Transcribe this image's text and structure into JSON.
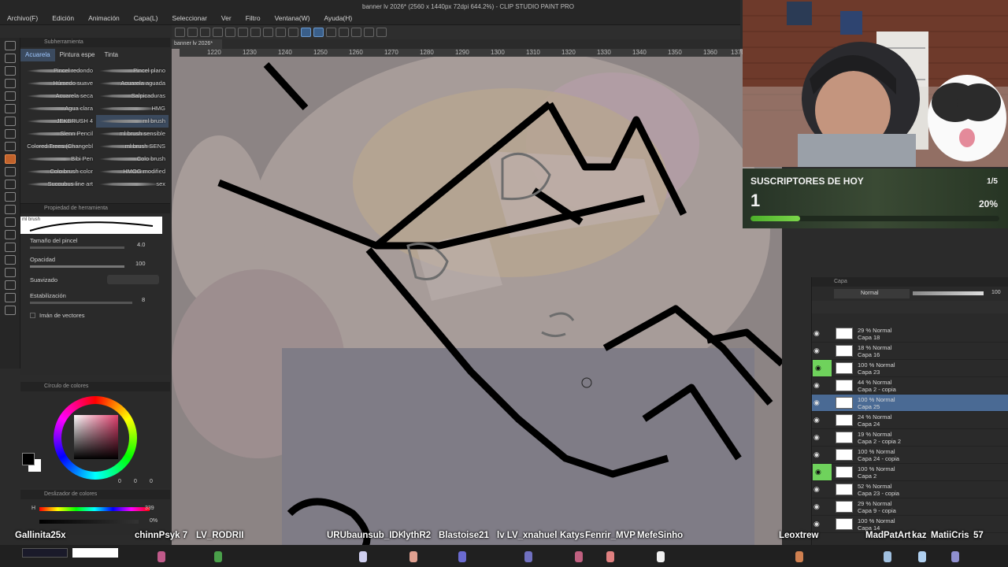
{
  "window": {
    "title": "banner lv 2026* (2560 x 1440px 72dpi 644.2%) - CLIP STUDIO PAINT PRO"
  },
  "menu": [
    "Archivo(F)",
    "Edición",
    "Animación",
    "Capa(L)",
    "Seleccionar",
    "Ver",
    "Filtro",
    "Ventana(W)",
    "Ayuda(H)"
  ],
  "document_tab": "banner lv 2026*",
  "ruler": [
    "1220",
    "1230",
    "1240",
    "1250",
    "1260",
    "1270",
    "1280",
    "1290",
    "1300",
    "1310",
    "1320",
    "1330",
    "1340",
    "1350",
    "1360",
    "1370"
  ],
  "subtool": {
    "panel_title": "Subherramienta",
    "tabs": [
      "Acuarela",
      "Pintura espe",
      "Tinta"
    ],
    "active_tab": "Acuarela",
    "brushes": [
      [
        "Pincel redondo",
        "Pincel plano"
      ],
      [
        "Húmedo suave",
        "Acuarela aguada"
      ],
      [
        "Acuarela seca",
        "Salpicaduras"
      ],
      [
        "Agua clara",
        "HMG"
      ],
      [
        "JEKBRUSH 4",
        "ml brush"
      ],
      [
        "Slenn Pencil",
        "ml brush sensible"
      ],
      [
        "Colored Trees (Changebl",
        "ml brush SENS"
      ],
      [
        "Bibi Pen",
        "Colo brush"
      ],
      [
        "Colo brush color",
        "HMOG modified"
      ],
      [
        "Succubus line art",
        "sex"
      ]
    ],
    "selected_brush": "ml brush"
  },
  "tool_property": {
    "panel_title": "Propiedad de herramienta",
    "brush_name": "ml brush",
    "size_label": "Tamaño del pincel",
    "size_value": "4.0",
    "opacity_label": "Opacidad",
    "opacity_value": "100",
    "smoothing_label": "Suavizado",
    "stabilization_label": "Estabilización",
    "stabilization_value": "8",
    "vector_magnet_label": "Imán de vectores"
  },
  "color_wheel": {
    "panel_title": "Círculo de colores",
    "values": [
      "0",
      "0",
      "0"
    ],
    "foreground": "#000000",
    "background": "#ffffff"
  },
  "color_slider": {
    "panel_title": "Deslizador de colores",
    "h_label": "H",
    "h_value": "339",
    "v_value": "0%"
  },
  "stream": {
    "subs_title": "SUSCRIPTORES DE HOY",
    "subs_count": "1",
    "subs_goal": "1/5",
    "subs_percent": "20%",
    "subs_progress": 0.2
  },
  "layers": {
    "panel_title": "Capa",
    "blend_mode": "Normal",
    "opacity": "100",
    "items": [
      {
        "pct": "29 % Normal",
        "name": "Capa 18",
        "visible_marker": ""
      },
      {
        "pct": "18 % Normal",
        "name": "Capa 16",
        "visible_marker": ""
      },
      {
        "pct": "100 % Normal",
        "name": "Capa 23",
        "visible_marker": "green"
      },
      {
        "pct": "44 % Normal",
        "name": "Capa 2 - copia",
        "visible_marker": ""
      },
      {
        "pct": "100 % Normal",
        "name": "Capa 25",
        "visible_marker": "selected"
      },
      {
        "pct": "24 % Normal",
        "name": "Capa 24",
        "visible_marker": ""
      },
      {
        "pct": "19 % Normal",
        "name": "Capa 2 - copia 2",
        "visible_marker": ""
      },
      {
        "pct": "100 % Normal",
        "name": "Capa 24 - copia",
        "visible_marker": ""
      },
      {
        "pct": "100 % Normal",
        "name": "Capa 2",
        "visible_marker": "green"
      },
      {
        "pct": "52 % Normal",
        "name": "Capa 23 - copia",
        "visible_marker": ""
      },
      {
        "pct": "29 % Normal",
        "name": "Capa 9 - copia",
        "visible_marker": ""
      },
      {
        "pct": "100 % Normal",
        "name": "Capa 14",
        "visible_marker": ""
      }
    ]
  },
  "chat_names": [
    "Gallinita25x",
    "chinnPsyk 7",
    "LV_RODRII",
    "URUbaunsub_IDK",
    "lythR2",
    "Blastoise21",
    "lv LV_xnahuel",
    "Katys",
    "Fenrir_MVP",
    "MefeSinho",
    "Leoxtrew",
    "MadPatArt",
    "kaz",
    "MatiiCris",
    "57"
  ]
}
